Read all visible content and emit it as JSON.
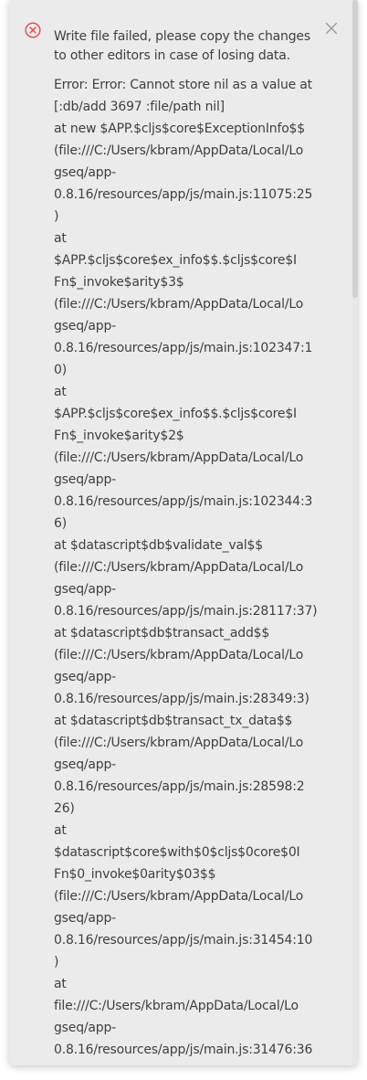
{
  "notification": {
    "type": "error",
    "icon": "error-circle-x-icon",
    "close_icon": "close-icon",
    "colors": {
      "panel_bg": "#ebebeb",
      "error_red": "#e05252",
      "text": "#3f3f3f",
      "close": "#9a9a9a"
    },
    "title": "Write file failed, please copy the changes\nto other editors in case of losing data.",
    "detail_lines": [
      "Error: Error: Cannot store nil as a value at",
      "[:db/add 3697 :file/path nil]",
      "at new $APP.$cljs$core$ExceptionInfo$$",
      "(file:///C:/Users/kbram/AppData/Local/Lo",
      "gseq/app-",
      "0.8.16/resources/app/js/main.js:11075:25",
      ")",
      "at",
      "$APP.$cljs$core$ex_info$$.$cljs$core$I",
      "Fn$_invoke$arity$3$",
      "(file:///C:/Users/kbram/AppData/Local/Lo",
      "gseq/app-",
      "0.8.16/resources/app/js/main.js:102347:1",
      "0)",
      "at",
      "$APP.$cljs$core$ex_info$$.$cljs$core$I",
      "Fn$_invoke$arity$2$",
      "(file:///C:/Users/kbram/AppData/Local/Lo",
      "gseq/app-",
      "0.8.16/resources/app/js/main.js:102344:3",
      "6)",
      "at $datascript$db$validate_val$$",
      "(file:///C:/Users/kbram/AppData/Local/Lo",
      "gseq/app-",
      "0.8.16/resources/app/js/main.js:28117:37)",
      "at $datascript$db$transact_add$$",
      "(file:///C:/Users/kbram/AppData/Local/Lo",
      "gseq/app-",
      "0.8.16/resources/app/js/main.js:28349:3)",
      "at $datascript$db$transact_tx_data$$",
      "(file:///C:/Users/kbram/AppData/Local/Lo",
      "gseq/app-",
      "0.8.16/resources/app/js/main.js:28598:2",
      "26)",
      "at",
      "$datascript$core$with$0$cljs$0core$0I",
      "Fn$0_invoke$0arity$03$$",
      "(file:///C:/Users/kbram/AppData/Local/Lo",
      "gseq/app-",
      "0.8.16/resources/app/js/main.js:31454:10",
      ")",
      "at",
      "file:///C:/Users/kbram/AppData/Local/Lo",
      "gseq/app-",
      "0.8.16/resources/app/js/main.js:31476:36"
    ]
  }
}
